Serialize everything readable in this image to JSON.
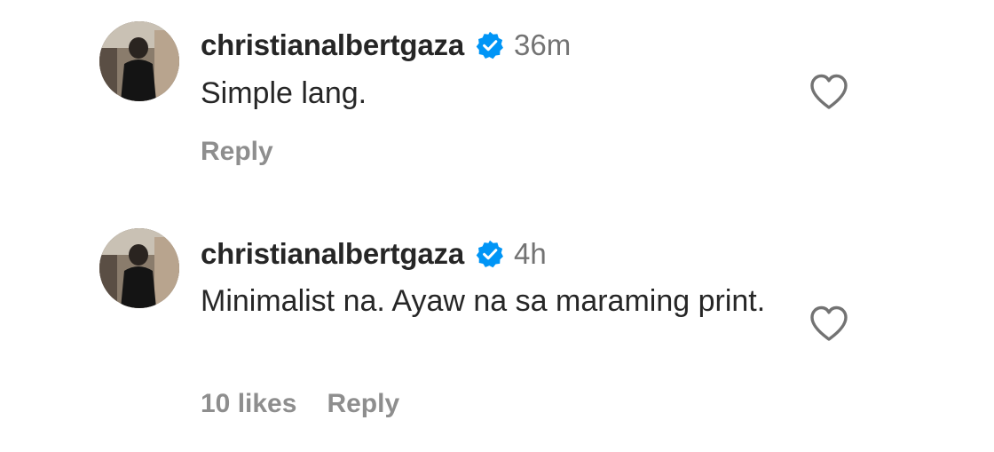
{
  "comments": [
    {
      "username": "christianalbertgaza",
      "verified": true,
      "timestamp": "36m",
      "text": "Simple lang.",
      "likes_label": "",
      "reply_label": "Reply",
      "avatar_icon": "profile-photo"
    },
    {
      "username": "christianalbertgaza",
      "verified": true,
      "timestamp": "4h",
      "text": "Minimalist na. Ayaw na sa maraming print.",
      "likes_label": "10 likes",
      "reply_label": "Reply",
      "avatar_icon": "profile-photo"
    }
  ],
  "icons": {
    "verified": "verified-badge-icon",
    "like": "heart-outline-icon"
  },
  "colors": {
    "text_primary": "#262626",
    "text_secondary": "#737373",
    "action_text": "#8e8e8e",
    "verified_blue": "#0095f6",
    "background": "#ffffff"
  }
}
